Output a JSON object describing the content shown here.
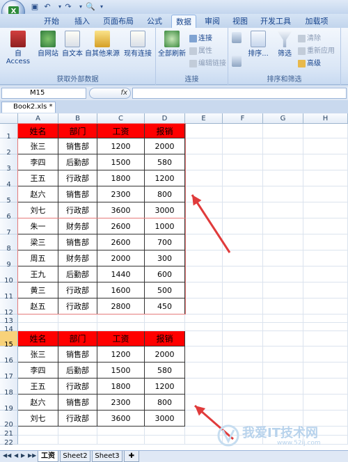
{
  "title_bar": {
    "icons": [
      "excel-app-icon",
      "save-icon",
      "undo-icon",
      "redo-icon",
      "print-preview-icon",
      "customize-icon"
    ]
  },
  "tabs": [
    "开始",
    "插入",
    "页面布局",
    "公式",
    "数据",
    "审阅",
    "视图",
    "开发工具",
    "加载项"
  ],
  "active_tab": "数据",
  "ribbon": {
    "external": {
      "title": "获取外部数据",
      "buttons": [
        "自 Access",
        "自网站",
        "自文本",
        "自其他来源",
        "现有连接"
      ]
    },
    "connections": {
      "title": "连接",
      "refresh": "全部刷新",
      "items": [
        "连接",
        "属性",
        "编辑链接"
      ]
    },
    "sort_filter": {
      "title": "排序和筛选",
      "sort": "排序...",
      "filter": "筛选",
      "items": [
        "清除",
        "重新应用",
        "高级"
      ]
    }
  },
  "formula_bar": {
    "name_box": "M15",
    "fx": "fx",
    "value": ""
  },
  "document_tab": "Book2.xls *",
  "columns": [
    "A",
    "B",
    "C",
    "D",
    "E",
    "F",
    "G",
    "H"
  ],
  "rows": [
    "1",
    "2",
    "3",
    "4",
    "5",
    "6",
    "7",
    "8",
    "9",
    "10",
    "11",
    "12",
    "13",
    "14",
    "15",
    "16",
    "17",
    "18",
    "19",
    "20",
    "21",
    "22"
  ],
  "table1": {
    "headers": [
      "姓名",
      "部门",
      "工资",
      "报销"
    ],
    "rows": [
      [
        "张三",
        "销售部",
        "1200",
        "2000"
      ],
      [
        "李四",
        "后勤部",
        "1500",
        "580"
      ],
      [
        "王五",
        "行政部",
        "1800",
        "1200"
      ],
      [
        "赵六",
        "销售部",
        "2300",
        "800"
      ],
      [
        "刘七",
        "行政部",
        "3600",
        "3000"
      ],
      [
        "朱一",
        "财务部",
        "2600",
        "1000"
      ],
      [
        "梁三",
        "销售部",
        "2600",
        "700"
      ],
      [
        "周五",
        "财务部",
        "2000",
        "300"
      ],
      [
        "王九",
        "后勤部",
        "1440",
        "600"
      ],
      [
        "黄三",
        "行政部",
        "1600",
        "500"
      ],
      [
        "赵五",
        "行政部",
        "2800",
        "450"
      ]
    ]
  },
  "table2": {
    "headers": [
      "姓名",
      "部门",
      "工资",
      "报销"
    ],
    "rows": [
      [
        "张三",
        "销售部",
        "1200",
        "2000"
      ],
      [
        "李四",
        "后勤部",
        "1500",
        "580"
      ],
      [
        "王五",
        "行政部",
        "1800",
        "1200"
      ],
      [
        "赵六",
        "销售部",
        "2300",
        "800"
      ],
      [
        "刘七",
        "行政部",
        "3600",
        "3000"
      ]
    ]
  },
  "sheets": [
    "工资",
    "Sheet2",
    "Sheet3"
  ],
  "active_sheet": "工资",
  "watermark": {
    "text": "我爱IT技术网",
    "url": "www.52ij.com"
  },
  "colors": {
    "header_fill": "#ff0000",
    "accent": "#15428b",
    "arrow": "#e03b3b",
    "selected_row": "#f8d27a"
  }
}
